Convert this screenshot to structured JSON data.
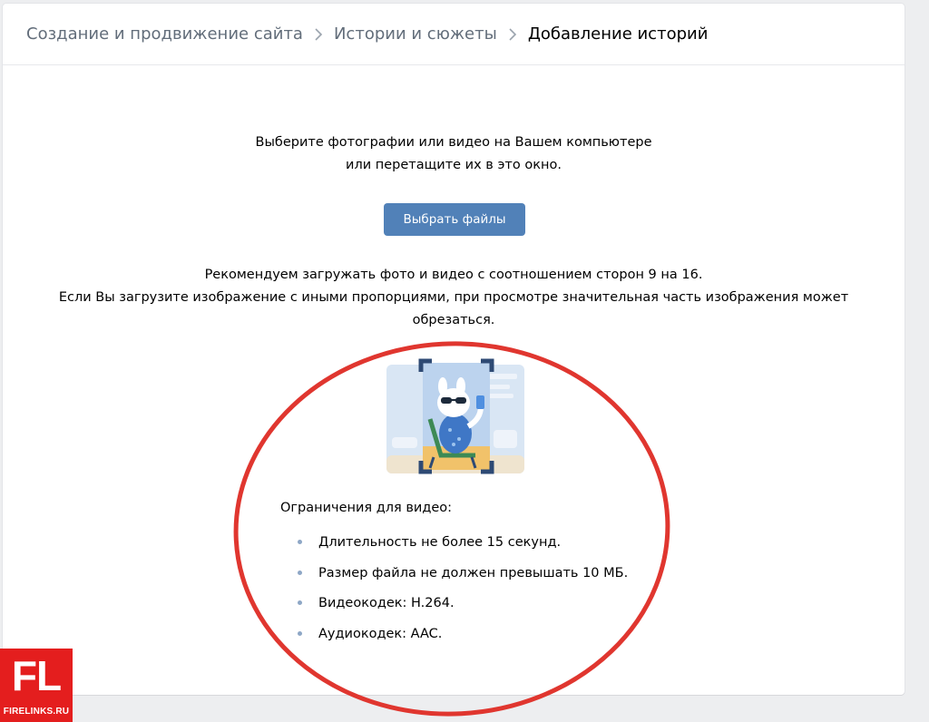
{
  "breadcrumbs": {
    "items": [
      {
        "label": "Создание и продвижение сайта"
      },
      {
        "label": "Истории и сюжеты"
      },
      {
        "label": "Добавление историй"
      }
    ]
  },
  "upload": {
    "instruction_line1": "Выберите фотографии или видео на Вашем компьютере",
    "instruction_line2": "или перетащите их в это окно.",
    "select_button_label": "Выбрать файлы",
    "recommendation_line1": "Рекомендуем загружать фото и видео с соотношением сторон 9 на 16.",
    "recommendation_line2": "Если Вы загрузите изображение с иными пропорциями, при просмотре значительная часть изображения может",
    "recommendation_line3": "обрезаться."
  },
  "illustration": {
    "icon": "story-crop-illustration"
  },
  "video_limits": {
    "title": "Ограничения для видео:",
    "items": [
      "Длительность не более 15 секунд.",
      "Размер файла не должен превышать 10 МБ.",
      "Видеокодек: H.264.",
      "Аудиокодек: AAC."
    ]
  },
  "watermark": {
    "mark": "FL",
    "site": "FIRELINKS.RU"
  },
  "colors": {
    "accent_button": "#5181b8",
    "annotation_red": "#e0362f",
    "watermark_red": "#e41e1e",
    "page_background": "#edeef0"
  }
}
